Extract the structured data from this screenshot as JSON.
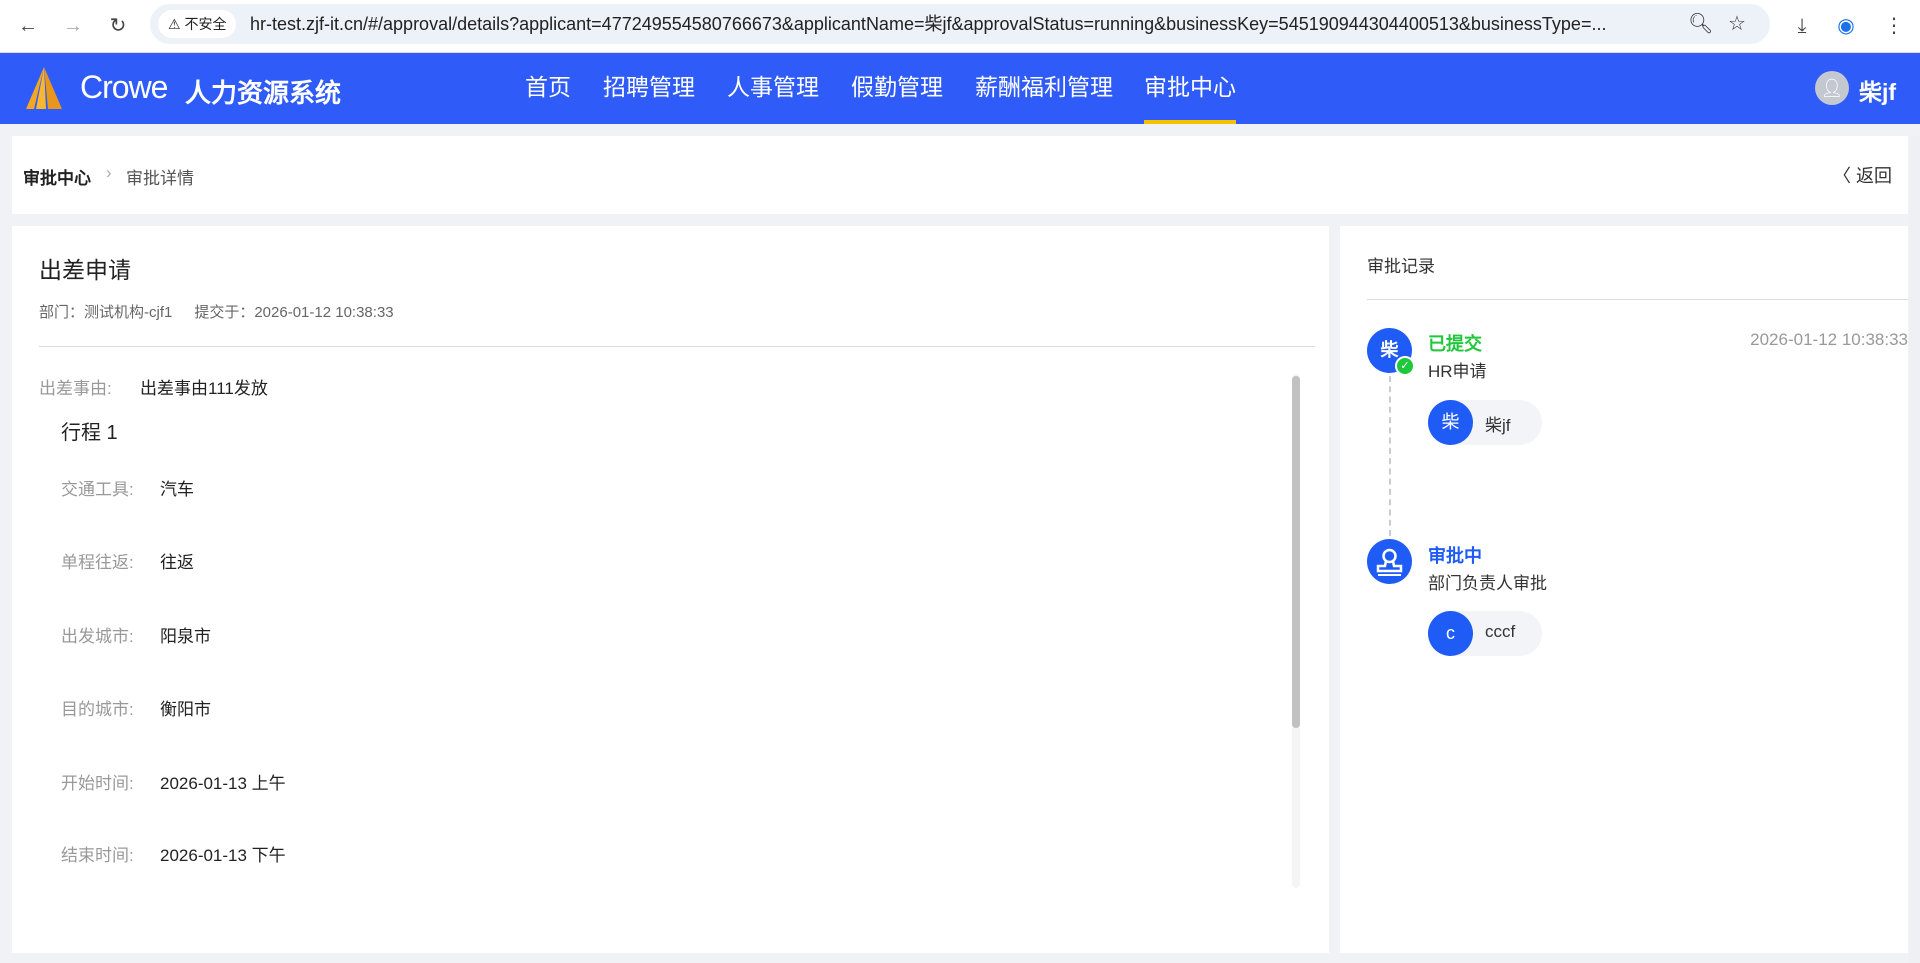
{
  "browser": {
    "security": "不安全",
    "url": "hr-test.zjf-it.cn/#/approval/details?applicant=477249554580766673&applicantName=柴jf&approvalStatus=running&businessKey=545190944304400513&businessType=..."
  },
  "header": {
    "brand": "Crowe",
    "system": "人力资源系统",
    "nav": [
      "首页",
      "招聘管理",
      "人事管理",
      "假勤管理",
      "薪酬福利管理",
      "审批中心"
    ],
    "active": "审批中心",
    "user_initial": "●",
    "user": "柴jf"
  },
  "breadcrumb": {
    "root": "审批中心",
    "sep": ">",
    "current": "审批详情",
    "back": "返回"
  },
  "detail": {
    "title": "出差申请",
    "dept": "部门：测试机构-cjf1",
    "submitted": "提交于：2026-01-12 10:38:33",
    "reason_label": "出差事由:",
    "reason": "出差事由111发放",
    "trip_title": "行程 1",
    "fields": [
      {
        "label": "交通工具:",
        "value": "汽车"
      },
      {
        "label": "单程往返:",
        "value": "往返"
      },
      {
        "label": "出发城市:",
        "value": "阳泉市"
      },
      {
        "label": "目的城市:",
        "value": "衡阳市"
      },
      {
        "label": "开始时间:",
        "value": "2026-01-13 上午"
      },
      {
        "label": "结束时间:",
        "value": "2026-01-13 下午"
      }
    ]
  },
  "records": {
    "title": "审批记录",
    "items": [
      {
        "avatar": "柴",
        "status": "已提交",
        "status_color": "#1ec73b",
        "step": "HR申请",
        "time": "2026-01-12 10:38:33",
        "person_avatar": "柴",
        "person": "柴jf"
      },
      {
        "avatar": "",
        "status": "审批中",
        "status_color": "#1f5cf6",
        "step": "部门负责人审批",
        "person_avatar": "c",
        "person": "cccf"
      }
    ]
  }
}
